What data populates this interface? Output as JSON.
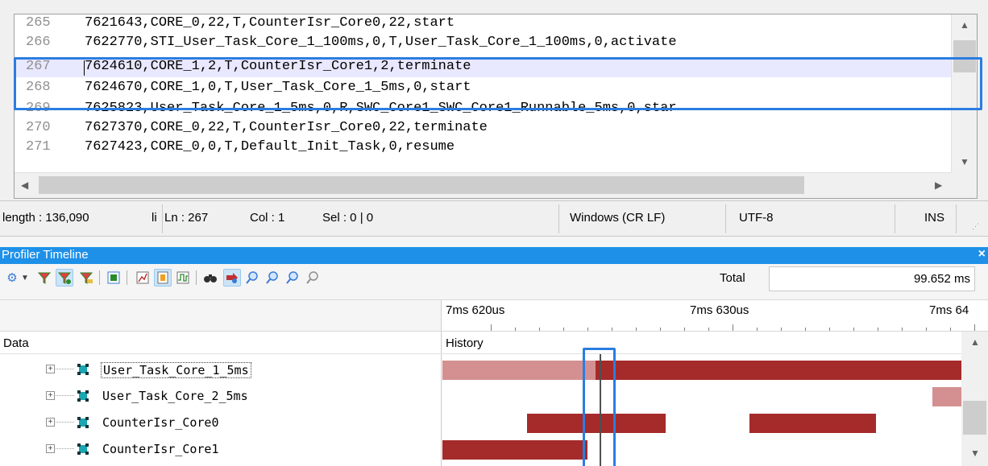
{
  "editor": {
    "lines": [
      {
        "num": "265",
        "text": "7621643,CORE_0,22,T,CounterIsr_Core0,22,start"
      },
      {
        "num": "266",
        "text": "7622770,STI_User_Task_Core_1_100ms,0,T,User_Task_Core_1_100ms,0,activate"
      },
      {
        "num": "267",
        "text": "7624610,CORE_1,2,T,CounterIsr_Core1,2,terminate"
      },
      {
        "num": "268",
        "text": "7624670,CORE_1,0,T,User_Task_Core_1_5ms,0,start"
      },
      {
        "num": "269",
        "text": "7625823,User_Task_Core_1_5ms,0,R,SWC_Core1_SWC_Core1_Runnable_5ms,0,star"
      },
      {
        "num": "270",
        "text": "7627370,CORE_0,22,T,CounterIsr_Core0,22,terminate"
      },
      {
        "num": "271",
        "text": "7627423,CORE_0,0,T,Default_Init_Task,0,resume"
      }
    ],
    "current_line": "267"
  },
  "statusbar": {
    "length": "length : 136,090",
    "lines_trunc": "li",
    "ln": "Ln : 267",
    "col": "Col : 1",
    "sel": "Sel : 0 | 0",
    "eol": "Windows (CR LF)",
    "encoding": "UTF-8",
    "mode": "INS"
  },
  "profiler": {
    "title": "Profiler Timeline",
    "close": "×",
    "total_label": "Total",
    "total_value": "99.652 ms",
    "ruler": [
      "7ms 620us",
      "7ms 630us",
      "7ms 64"
    ],
    "data_header": "Data",
    "history_header": "History",
    "tasks": [
      {
        "name": "User_Task_Core_1_5ms",
        "selected": true
      },
      {
        "name": "User_Task_Core_2_5ms",
        "selected": false
      },
      {
        "name": "CounterIsr_Core0",
        "selected": false
      },
      {
        "name": "CounterIsr_Core1",
        "selected": false
      }
    ],
    "toolbar_icons": [
      "gear-icon",
      "dropdown-arrow-icon",
      "filter-icon",
      "filter-active-icon",
      "filter-edit-icon",
      "export-icon",
      "chart-icon",
      "highlight-icon",
      "waveform-icon",
      "binoculars-icon",
      "goto-icon",
      "zoom-in-icon",
      "zoom-out-icon",
      "zoom-fit-icon",
      "zoom-reset-icon"
    ]
  },
  "colors": {
    "bar_dark": "#a52a2a",
    "bar_light": "#d49090",
    "highlight_blue": "#2b7de1",
    "title_blue": "#1e90e8"
  }
}
